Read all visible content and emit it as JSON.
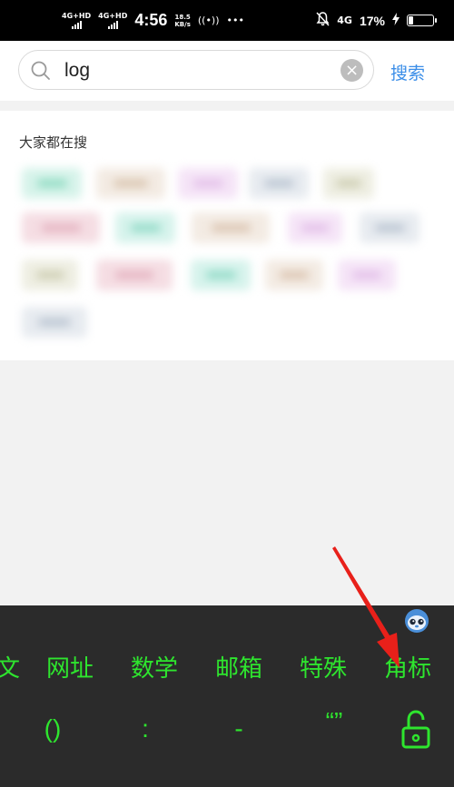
{
  "status_bar": {
    "signal1_label": "4G+HD",
    "signal2_label": "4G+HD",
    "time": "4:56",
    "speed_value": "18.5",
    "speed_unit": "KB/s",
    "hotspot_icon": "((•))",
    "more_icon": "•••",
    "network_type": "4G",
    "battery_percent": "17%",
    "battery_level": 0.17
  },
  "search": {
    "query": "log",
    "submit_label": "搜索"
  },
  "hot_searches": {
    "title": "大家都在搜"
  },
  "keyboard": {
    "tabs": [
      "文",
      "网址",
      "数学",
      "邮箱",
      "特殊",
      "角标"
    ],
    "symbols": [
      "()",
      ":",
      "-",
      "“”"
    ],
    "text_color": "#2ee52e"
  },
  "annotation": {
    "arrow_color": "#e8201a"
  }
}
